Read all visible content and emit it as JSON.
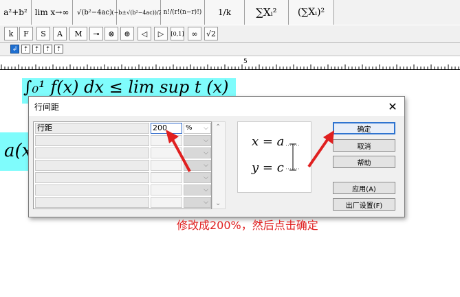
{
  "palette": {
    "templates": [
      "a²+b²",
      "lim x→∞",
      "√(b²−4ac)",
      "(−b±√(b²−4ac))/2a",
      "n!/(r!(n−r)!)",
      "1/k",
      "∑Xᵢ²",
      "(∑Xᵢ)²"
    ]
  },
  "symbols": [
    "k",
    "F",
    "S",
    "A",
    "M",
    "⊸",
    "⊗",
    "⊕",
    "◁",
    "▷",
    "[0,1]",
    "∞",
    "√2"
  ],
  "ruler": {
    "mark_5": "5"
  },
  "document": {
    "line1": "∫₀¹ f(x) dx ≤ lim sup t (x)",
    "line2_fragment": "a(x"
  },
  "dialog": {
    "title": "行间距",
    "close_label": "✕",
    "rows": [
      {
        "label": "行距",
        "value": "200",
        "unit": "%"
      },
      {
        "label": "",
        "value": "",
        "unit": ""
      },
      {
        "label": "",
        "value": "",
        "unit": ""
      },
      {
        "label": "",
        "value": "",
        "unit": ""
      },
      {
        "label": "",
        "value": "",
        "unit": ""
      },
      {
        "label": "",
        "value": "",
        "unit": ""
      },
      {
        "label": "",
        "value": "",
        "unit": ""
      }
    ],
    "preview": {
      "line1": "x = a",
      "line2": "y = c"
    },
    "buttons": {
      "ok": "确定",
      "cancel": "取消",
      "help": "帮助",
      "apply": "应用(A)",
      "factory": "出厂设置(F)"
    }
  },
  "annotation": {
    "text": "修改成200%，然后点击确定",
    "color": "#e02020"
  }
}
